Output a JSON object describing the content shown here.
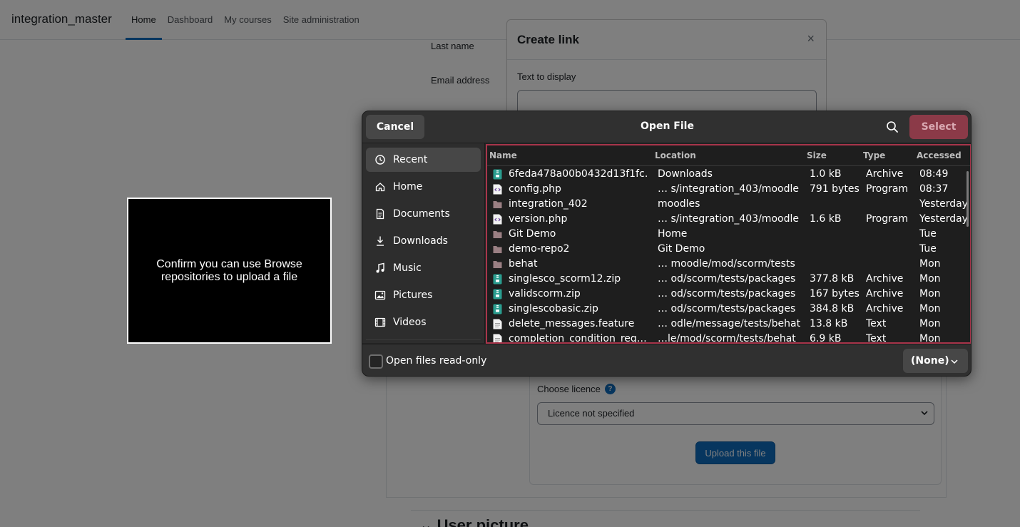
{
  "site": {
    "brand": "integration_master",
    "nav": [
      "Home",
      "Dashboard",
      "My courses",
      "Site administration"
    ]
  },
  "form": {
    "last_name_label": "Last name",
    "email_label": "Email address"
  },
  "create_link": {
    "title": "Create link",
    "close_glyph": "×",
    "text_label": "Text to display"
  },
  "file_picker": {
    "licence_label": "Choose licence",
    "help_glyph": "?",
    "licence_value": "Licence not specified",
    "upload_button": "Upload this file",
    "section_title": "User picture",
    "section_glyph": "⌄"
  },
  "instruction": {
    "text": "Confirm you can use Browse repositories to upload a file"
  },
  "dialog": {
    "title": "Open File",
    "cancel_label": "Cancel",
    "select_label": "Select",
    "sidebar": [
      {
        "label": "Recent",
        "icon": "recent-icon",
        "selected": true
      },
      {
        "label": "Home",
        "icon": "home-icon"
      },
      {
        "label": "Documents",
        "icon": "documents-icon"
      },
      {
        "label": "Downloads",
        "icon": "downloads-icon"
      },
      {
        "label": "Music",
        "icon": "music-icon"
      },
      {
        "label": "Pictures",
        "icon": "pictures-icon"
      },
      {
        "label": "Videos",
        "icon": "videos-icon"
      }
    ],
    "columns": {
      "name": "Name",
      "location": "Location",
      "size": "Size",
      "type": "Type",
      "accessed": "Accessed"
    },
    "files": [
      {
        "name": "6feda478a00b0432d13f1fc…",
        "location": "Downloads",
        "size": "1.0 kB",
        "type": "Archive",
        "accessed": "08:49",
        "icon": "archive"
      },
      {
        "name": "config.php",
        "location": "… s/integration_403/moodle",
        "size": "791 bytes",
        "type": "Program",
        "accessed": "08:37",
        "icon": "code"
      },
      {
        "name": "integration_402",
        "location": "moodles",
        "size": "",
        "type": "",
        "accessed": "Yesterday",
        "icon": "folder"
      },
      {
        "name": "version.php",
        "location": "… s/integration_403/moodle",
        "size": "1.6 kB",
        "type": "Program",
        "accessed": "Yesterday",
        "icon": "code"
      },
      {
        "name": "Git Demo",
        "location": "Home",
        "size": "",
        "type": "",
        "accessed": "Tue",
        "icon": "folder"
      },
      {
        "name": "demo-repo2",
        "location": "Git Demo",
        "size": "",
        "type": "",
        "accessed": "Tue",
        "icon": "folder"
      },
      {
        "name": "behat",
        "location": "… moodle/mod/scorm/tests",
        "size": "",
        "type": "",
        "accessed": "Mon",
        "icon": "folder"
      },
      {
        "name": "singlesco_scorm12.zip",
        "location": "… od/scorm/tests/packages",
        "size": "377.8 kB",
        "type": "Archive",
        "accessed": "Mon",
        "icon": "archive"
      },
      {
        "name": "validscorm.zip",
        "location": "… od/scorm/tests/packages",
        "size": "167 bytes",
        "type": "Archive",
        "accessed": "Mon",
        "icon": "archive"
      },
      {
        "name": "singlescobasic.zip",
        "location": "… od/scorm/tests/packages",
        "size": "384.8 kB",
        "type": "Archive",
        "accessed": "Mon",
        "icon": "archive"
      },
      {
        "name": "delete_messages.feature",
        "location": "… odle/message/tests/behat",
        "size": "13.8 kB",
        "type": "Text",
        "accessed": "Mon",
        "icon": "text"
      },
      {
        "name": "completion_condition_req…",
        "location": "…le/mod/scorm/tests/behat",
        "size": "6.9 kB",
        "type": "Text",
        "accessed": "Mon",
        "icon": "text"
      }
    ],
    "read_only_label": "Open files read-only",
    "filter_value": "(None)"
  },
  "colors": {
    "select_button": "#8b3a48",
    "list_focus_border": "#a8354b",
    "moodle_primary": "#0f6cbf",
    "archive_icon": "#2a9d8f",
    "folder_icon": "#9a7f83"
  }
}
